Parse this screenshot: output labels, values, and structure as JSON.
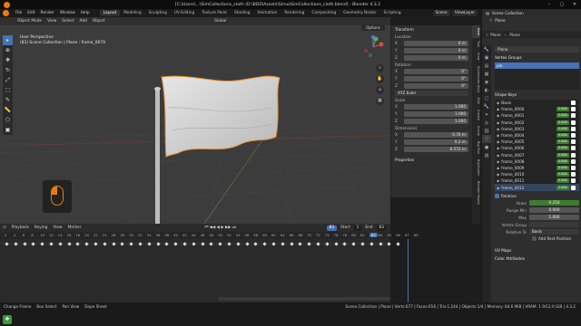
{
  "window": {
    "title": "[C:\\Users\\...\\SimCollections_cloth (D:\\BDD\\Assets\\Simu\\SimCollections_cloth.blend] - Blender 4.3.2",
    "controls": [
      "–",
      "▢",
      "✕"
    ]
  },
  "menu": {
    "items": [
      "File",
      "Edit",
      "Render",
      "Window",
      "Help"
    ],
    "workspaces": [
      "Layout",
      "Modeling",
      "Sculpting",
      "UV Editing",
      "Texture Paint",
      "Shading",
      "Animation",
      "Rendering",
      "Compositing",
      "Geometry Nodes",
      "Scripting"
    ],
    "active_workspace": "Layout",
    "scene_label": "Scene",
    "view_layer_label": "ViewLayer"
  },
  "viewport": {
    "mode": "Object Mode",
    "header_items": [
      "View",
      "Select",
      "Add",
      "Object"
    ],
    "orientation": "Global",
    "overlay_line1": "User Perspective",
    "overlay_line2": "(83) Scene Collection | Plane : frame_0079",
    "options_label": "Options",
    "tools": [
      "▸",
      "✥",
      "⊕",
      "↻",
      "⤢",
      "⬚",
      "✎",
      "📏",
      "⬡",
      "▣"
    ]
  },
  "npanel": {
    "transform_label": "Transform",
    "location_label": "Location",
    "location": [
      {
        "k": "X",
        "v": "0 m"
      },
      {
        "k": "Y",
        "v": "0 m"
      },
      {
        "k": "Z",
        "v": "0 m"
      }
    ],
    "rotation_label": "Rotation",
    "rotation": [
      {
        "k": "X",
        "v": "0°"
      },
      {
        "k": "Y",
        "v": "0°"
      },
      {
        "k": "Z",
        "v": "0°"
      }
    ],
    "rotation_mode": "XYZ Euler",
    "scale_label": "Scale",
    "scale": [
      {
        "k": "X",
        "v": "1.000"
      },
      {
        "k": "Y",
        "v": "1.000"
      },
      {
        "k": "Z",
        "v": "1.000"
      }
    ],
    "dimensions_label": "Dimensions",
    "dimensions": [
      {
        "k": "X",
        "v": "0.76 m"
      },
      {
        "k": "Y",
        "v": "0.2 m"
      },
      {
        "k": "Z",
        "v": "0.572 m"
      }
    ],
    "properties_label": "Properties",
    "side_tabs": [
      "Item",
      "Tool",
      "View",
      "Screencast Keys",
      "Edit",
      "Create",
      "Scene",
      "Big Tool",
      "BoxCutter",
      "Blender Pastel"
    ]
  },
  "timeline": {
    "header_items": [
      "Playback",
      "Keying",
      "View",
      "Marker"
    ],
    "current_frame": "83",
    "start_label": "Start",
    "start_value": "1",
    "end_label": "End",
    "end_value": "83",
    "ruler_ticks": [
      "2",
      "4",
      "6",
      "8",
      "10",
      "12",
      "14",
      "16",
      "18",
      "20",
      "22",
      "24",
      "26",
      "28",
      "30",
      "32",
      "34",
      "36",
      "38",
      "40",
      "42",
      "44",
      "46",
      "48",
      "50",
      "52",
      "54",
      "56",
      "58",
      "60",
      "62",
      "64",
      "66",
      "68",
      "70",
      "72",
      "74",
      "76",
      "78",
      "80",
      "82",
      "83",
      "84",
      "85",
      "86",
      "87",
      "88"
    ]
  },
  "statusbar": {
    "left_items": [
      "Change Frame",
      "Box Select",
      "Pan View",
      "Dope Sheet"
    ],
    "right_text": "Scene Collection | Plane | Verts:677 | Faces:616 | Tris:1,244 | Objects:1/4 | Memory: 84.6 MiB | VRAM: 1.9/12.0 GiB | 4.3.2"
  },
  "properties": {
    "outliner_title": "Scene Collection",
    "outliner_item": "Plane",
    "breadcrumb_a": "Plane",
    "breadcrumb_b": "Plane",
    "mesh_name": "Plane",
    "vertex_groups_label": "Vertex Groups",
    "vertex_groups": [
      "pin"
    ],
    "shape_keys_label": "Shape Keys",
    "shape_keys": [
      {
        "name": "Basis",
        "value": ""
      },
      {
        "name": "frame_0000",
        "value": "0.000"
      },
      {
        "name": "frame_0001",
        "value": "0.000"
      },
      {
        "name": "frame_0002",
        "value": "0.000"
      },
      {
        "name": "frame_0003",
        "value": "0.000"
      },
      {
        "name": "frame_0004",
        "value": "0.000"
      },
      {
        "name": "frame_0005",
        "value": "0.000"
      },
      {
        "name": "frame_0006",
        "value": "0.000"
      },
      {
        "name": "frame_0007",
        "value": "0.000"
      },
      {
        "name": "frame_0008",
        "value": "0.000"
      },
      {
        "name": "frame_0009",
        "value": "0.000"
      },
      {
        "name": "frame_0010",
        "value": "0.000"
      },
      {
        "name": "frame_0011",
        "value": "0.000"
      },
      {
        "name": "frame_0012",
        "value": "0.000"
      }
    ],
    "relative_label": "Relative",
    "value_label": "Value",
    "value": "0.250",
    "range_min_label": "Range Min",
    "range_min": "0.000",
    "max_label": "Max",
    "max": "1.000",
    "vertex_group_label": "Vertex Group",
    "relative_to_label": "Relative To",
    "relative_to": "Basis",
    "add_rest_label": "Add Rest Position",
    "uv_maps_label": "UV Maps",
    "color_attributes_label": "Color Attributes"
  },
  "colors": {
    "accent": "#4772b3",
    "brand": "#e87d0d",
    "selection_outline": "#e8922b",
    "shape_value": "#3c7d2e"
  }
}
